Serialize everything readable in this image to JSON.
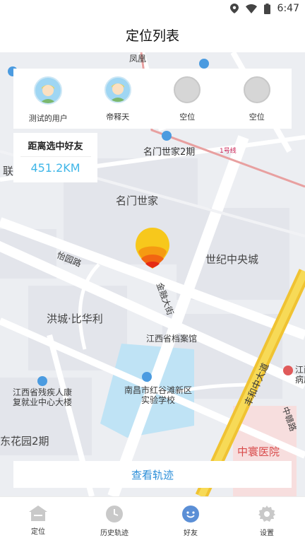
{
  "status_bar": {
    "time": "6:47"
  },
  "header": {
    "title": "定位列表"
  },
  "friends": [
    {
      "name": "测试的用户",
      "selected": true,
      "has_photo": true
    },
    {
      "name": "帝释天",
      "selected": false,
      "has_photo": true
    },
    {
      "name": "空位",
      "selected": false,
      "has_photo": false
    },
    {
      "name": "空位",
      "selected": false,
      "has_photo": false
    }
  ],
  "distance": {
    "title": "距离选中好友",
    "value": "451.2KM"
  },
  "map": {
    "labels": {
      "fenghuang": "凤凰",
      "mingmen_2": "名门世家2期",
      "mingmen": "名门世家",
      "century": "世纪中央城",
      "yiyuan_road": "怡园路",
      "jinrong_street": "金融大街",
      "hongcheng": "洪城·比华利",
      "archives": "江西省档案馆",
      "school": "南昌市红谷滩新区实验学校",
      "disabled": "江西省残疾人康复就业中心大楼",
      "dongyuan": "东花园2期",
      "fenghe": "丰和中大道",
      "zhonghuan_hosp": "中寰医院",
      "zhongying": "中赣路",
      "subway": "1号线",
      "lian": "联",
      "jiang_right": "江西",
      "hospital_right": "病房"
    }
  },
  "track_button": {
    "label": "查看轨迹"
  },
  "nav": [
    {
      "label": "定位",
      "icon": "home-icon",
      "active": false
    },
    {
      "label": "历史轨迹",
      "icon": "clock-icon",
      "active": false
    },
    {
      "label": "好友",
      "icon": "friends-icon",
      "active": true
    },
    {
      "label": "设置",
      "icon": "gear-icon",
      "active": false
    }
  ],
  "colors": {
    "accent": "#2b8ed8",
    "distance": "#3fb6e8",
    "nav_inactive": "#c9c9c9",
    "nav_active": "#5b8fd6",
    "road_yellow": "#f5cf3a"
  }
}
